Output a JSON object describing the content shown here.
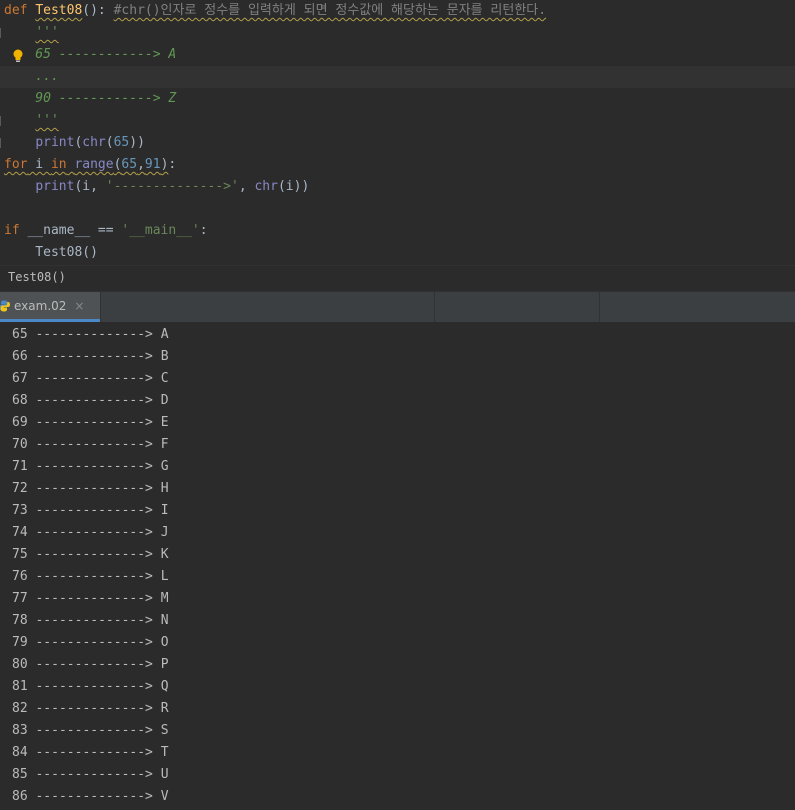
{
  "editor": {
    "lines": [
      {
        "tokens": [
          {
            "c": "kw",
            "t": "def "
          },
          {
            "c": "fn squiggle",
            "t": "Test08"
          },
          {
            "c": "plain",
            "t": "(): "
          },
          {
            "c": "cmt squiggle",
            "t": "#chr()인자로 정수를 입력하게 되면 정수값에 해당하는 문자를 리턴한다."
          }
        ]
      },
      {
        "tokens": [
          {
            "c": "doc",
            "t": "    "
          },
          {
            "c": "doc squiggle",
            "t": "'''"
          }
        ]
      },
      {
        "tokens": [
          {
            "c": "doc",
            "t": "    65 ------------> A"
          }
        ]
      },
      {
        "tokens": [
          {
            "c": "doc",
            "t": "    ..."
          }
        ]
      },
      {
        "tokens": [
          {
            "c": "doc",
            "t": "    90 ------------> Z"
          }
        ]
      },
      {
        "tokens": [
          {
            "c": "doc",
            "t": "    "
          },
          {
            "c": "doc squiggle",
            "t": "'''"
          }
        ]
      },
      {
        "tokens": [
          {
            "c": "plain",
            "t": "    "
          },
          {
            "c": "builtin",
            "t": "print"
          },
          {
            "c": "plain",
            "t": "("
          },
          {
            "c": "builtin",
            "t": "chr"
          },
          {
            "c": "plain",
            "t": "("
          },
          {
            "c": "num",
            "t": "65"
          },
          {
            "c": "plain",
            "t": "))"
          }
        ]
      },
      {
        "tokens": [
          {
            "c": "kw squiggle",
            "t": "for"
          },
          {
            "c": "plain squiggle",
            "t": " i "
          },
          {
            "c": "kw squiggle",
            "t": "in"
          },
          {
            "c": "plain squiggle",
            "t": " "
          },
          {
            "c": "builtin squiggle",
            "t": "range"
          },
          {
            "c": "plain squiggle",
            "t": "("
          },
          {
            "c": "num squiggle",
            "t": "65"
          },
          {
            "c": "plain squiggle",
            "t": ","
          },
          {
            "c": "num squiggle",
            "t": "91"
          },
          {
            "c": "plain squiggle",
            "t": ")"
          },
          {
            "c": "plain",
            "t": ":"
          }
        ]
      },
      {
        "tokens": [
          {
            "c": "plain",
            "t": "    "
          },
          {
            "c": "builtin",
            "t": "print"
          },
          {
            "c": "plain",
            "t": "(i, "
          },
          {
            "c": "str",
            "t": "'-------------->'"
          },
          {
            "c": "plain",
            "t": ", "
          },
          {
            "c": "builtin",
            "t": "chr"
          },
          {
            "c": "plain",
            "t": "(i))"
          }
        ]
      },
      {
        "tokens": []
      },
      {
        "tokens": [
          {
            "c": "kw",
            "t": "if "
          },
          {
            "c": "plain",
            "t": "__name__ == "
          },
          {
            "c": "str",
            "t": "'__main__'"
          },
          {
            "c": "plain",
            "t": ":"
          }
        ]
      },
      {
        "tokens": [
          {
            "c": "plain",
            "t": "    Test08()"
          }
        ]
      }
    ]
  },
  "breadcrumb": {
    "label": "Test08()"
  },
  "run_panel": {
    "tab_label": "exam.02",
    "close_glyph": "×"
  },
  "console": {
    "lines": [
      "65 --------------> A",
      "66 --------------> B",
      "67 --------------> C",
      "68 --------------> D",
      "69 --------------> E",
      "70 --------------> F",
      "71 --------------> G",
      "72 --------------> H",
      "73 --------------> I",
      "74 --------------> J",
      "75 --------------> K",
      "76 --------------> L",
      "77 --------------> M",
      "78 --------------> N",
      "79 --------------> O",
      "80 --------------> P",
      "81 --------------> Q",
      "82 --------------> R",
      "83 --------------> S",
      "84 --------------> T",
      "85 --------------> U",
      "86 --------------> V"
    ]
  },
  "colors": {
    "accent": "#4a88c7",
    "keyword": "#cc7832",
    "function": "#ffc66d",
    "string": "#6a8759",
    "number": "#6897bb"
  },
  "icons": {
    "intention": "lightbulb-icon",
    "run_tab": "python-icon",
    "close": "close-icon"
  }
}
